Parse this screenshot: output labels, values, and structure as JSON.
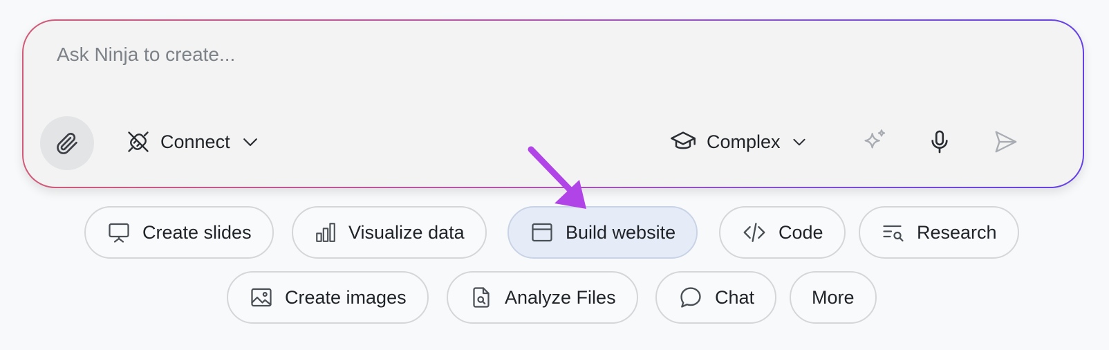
{
  "prompt": {
    "placeholder": "Ask Ninja to create...",
    "value": ""
  },
  "toolbar": {
    "attach_icon": "paperclip-icon",
    "connect_label": "Connect",
    "connect_icon": "plug-off-icon",
    "mode_label": "Complex",
    "mode_icon": "graduation-cap-icon",
    "sparkle_icon": "sparkle-icon",
    "mic_icon": "microphone-icon",
    "send_icon": "send-icon"
  },
  "chips": {
    "row1": [
      {
        "label": "Create slides",
        "icon": "presentation-icon"
      },
      {
        "label": "Visualize data",
        "icon": "bar-chart-icon"
      },
      {
        "label": "Build website",
        "icon": "browser-window-icon",
        "active": true
      },
      {
        "label": "Code",
        "icon": "code-icon"
      },
      {
        "label": "Research",
        "icon": "research-icon"
      }
    ],
    "row2": [
      {
        "label": "Create images",
        "icon": "image-icon"
      },
      {
        "label": "Analyze Files",
        "icon": "file-search-icon"
      },
      {
        "label": "Chat",
        "icon": "chat-bubble-icon"
      },
      {
        "label": "More"
      }
    ]
  },
  "colors": {
    "annotation_arrow": "#b044e6",
    "active_chip_bg": "#e6ecf7",
    "border_gradient_start": "#d05a78",
    "border_gradient_end": "#6440e6"
  }
}
